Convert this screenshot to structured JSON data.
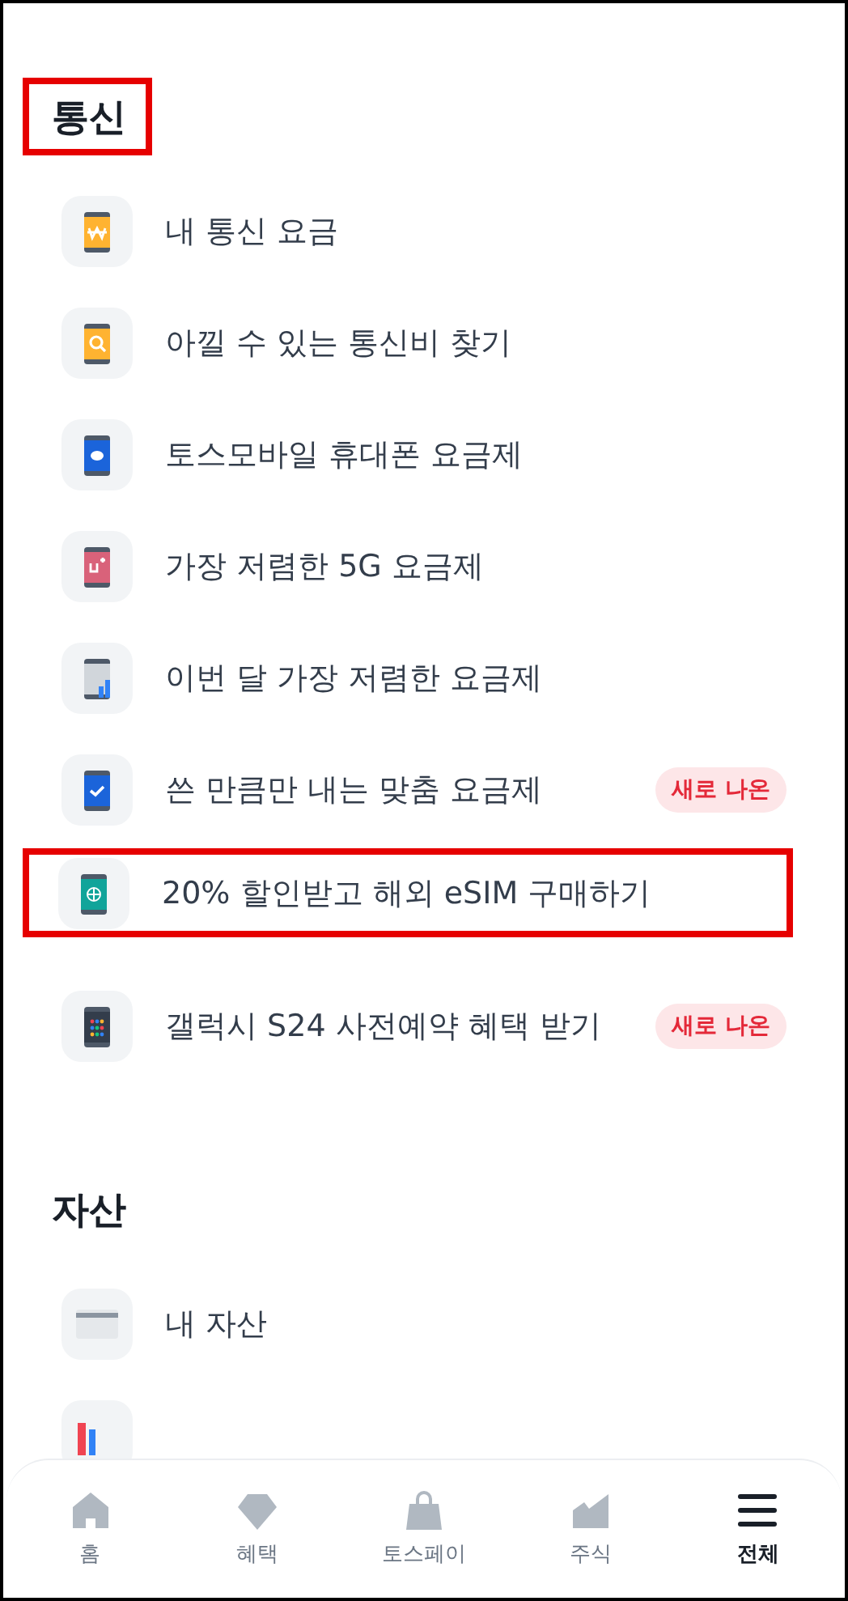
{
  "sections": [
    {
      "title": "통신",
      "highlighted": true,
      "items": [
        {
          "label": "내 통신 요금",
          "highlighted": false
        },
        {
          "label": "아낄 수 있는 통신비 찾기",
          "highlighted": false
        },
        {
          "label": "토스모바일 휴대폰 요금제",
          "highlighted": false
        },
        {
          "label": "가장 저렴한 5G 요금제",
          "highlighted": false
        },
        {
          "label": "이번 달 가장 저렴한 요금제",
          "highlighted": false
        },
        {
          "label": "쓴 만큼만 내는 맞춤 요금제",
          "badge": "새로 나온",
          "highlighted": false
        },
        {
          "label": "20% 할인받고 해외 eSIM 구매하기",
          "highlighted": true
        },
        {
          "label": "갤럭시 S24 사전예약 혜택 받기",
          "badge": "새로 나온",
          "highlighted": false
        }
      ]
    },
    {
      "title": "자산",
      "highlighted": false,
      "items": [
        {
          "label": "내 자산",
          "highlighted": false
        },
        {
          "highlighted": false
        }
      ]
    }
  ],
  "tab_bar": [
    {
      "label": "홈",
      "selected": false
    },
    {
      "label": "혜택",
      "selected": false
    },
    {
      "label": "토스페이",
      "selected": false
    },
    {
      "label": "주식",
      "selected": false
    },
    {
      "label": "전체",
      "selected": true
    }
  ]
}
